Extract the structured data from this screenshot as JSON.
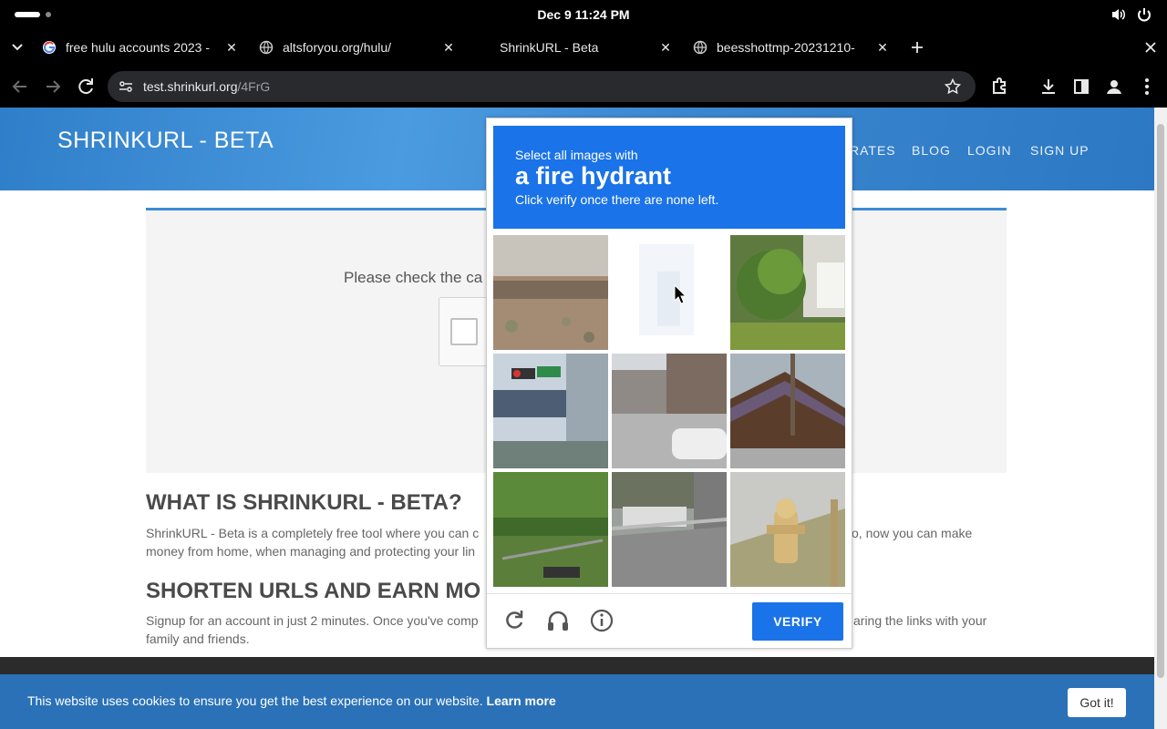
{
  "os": {
    "clock": "Dec 9  11:24 PM"
  },
  "tabs": [
    {
      "title": "free hulu accounts 2023 -",
      "icon": "google-icon"
    },
    {
      "title": "altsforyou.org/hulu/",
      "icon": "globe-icon"
    },
    {
      "title": "ShrinkURL - Beta",
      "icon": "none",
      "active": true
    },
    {
      "title": "beesshottmp-20231210-",
      "icon": "globe-icon"
    }
  ],
  "toolbar": {
    "url_host": "test.shrinkurl.org",
    "url_path": "/4FrG"
  },
  "site": {
    "logo": "SHRINKURL - BETA",
    "nav": [
      "RATES",
      "BLOG",
      "LOGIN",
      "SIGN UP"
    ],
    "card_text": "Please check the ca",
    "h1": "WHAT IS SHRINKURL - BETA?",
    "p1": "ShrinkURL - Beta is a completely free tool where you can c",
    "p1_tail": "o, now you can make",
    "p1_line2": "money from home, when managing and protecting your lin",
    "h2": "SHORTEN URLS AND EARN MO",
    "p2": "Signup for an account in just 2 minutes. Once you've comp",
    "p2_tail": "aring the links with your",
    "p2_line2": "family and friends."
  },
  "cookie": {
    "text": "This website uses cookies to ensure you get the best experience on our website.",
    "link": "Learn more",
    "button": "Got it!"
  },
  "captcha": {
    "line1": "Select all images with",
    "line2": "a fire hydrant",
    "line3": "Click verify once there are none left.",
    "verify_label": "VERIFY",
    "tiles": [
      "desert-landscape",
      "blank-fading",
      "tree-house",
      "traffic-light-street",
      "street-cars",
      "house-roof",
      "grass-fence",
      "bus-road",
      "fire-hydrant"
    ]
  },
  "colors": {
    "accent": "#1a73e8",
    "header_blue": "#3a86cf",
    "cookie_blue": "#2a71b7"
  }
}
